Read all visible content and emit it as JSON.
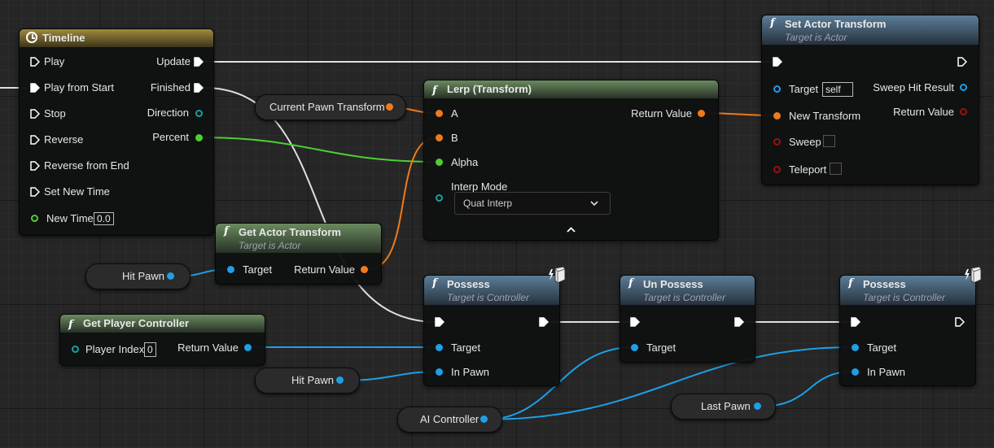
{
  "colors": {
    "exec": "#ffffff",
    "object": "#1e9fe6",
    "transform": "#f07a1a",
    "float": "#4fce32",
    "bool": "#9a1010",
    "int": "#1aa0a0"
  },
  "timeline": {
    "title": "Timeline",
    "icon": "clock-icon",
    "inputs": [
      "Play",
      "Play from Start",
      "Stop",
      "Reverse",
      "Reverse from End",
      "Set New Time",
      "New Time"
    ],
    "outputs": [
      "Update",
      "Finished",
      "Direction",
      "Percent"
    ],
    "new_time_value": "0.0"
  },
  "set_actor_transform": {
    "title": "Set Actor Transform",
    "subtitle": "Target is Actor",
    "target_label": "Target",
    "target_value": "self",
    "new_transform": "New Transform",
    "sweep": "Sweep",
    "teleport": "Teleport",
    "sweep_hit_result": "Sweep Hit Result",
    "return_value": "Return Value"
  },
  "current_pawn_transform": "Current Pawn Transform",
  "lerp": {
    "title": "Lerp (Transform)",
    "a": "A",
    "b": "B",
    "alpha": "Alpha",
    "interp_mode": "Interp Mode",
    "interp_value": "Quat Interp",
    "return_value": "Return Value"
  },
  "get_actor_transform": {
    "title": "Get Actor Transform",
    "subtitle": "Target is Actor",
    "target": "Target",
    "return_value": "Return Value"
  },
  "hit_pawn_var": "Hit Pawn",
  "get_player_controller": {
    "title": "Get Player Controller",
    "player_index": "Player Index",
    "player_index_value": "0",
    "return_value": "Return Value"
  },
  "hit_pawn_var2": "Hit Pawn",
  "possess1": {
    "title": "Possess",
    "subtitle": "Target is Controller",
    "target": "Target",
    "in_pawn": "In Pawn"
  },
  "unpossess": {
    "title": "Un Possess",
    "subtitle": "Target is Controller",
    "target": "Target"
  },
  "possess2": {
    "title": "Possess",
    "subtitle": "Target is Controller",
    "target": "Target",
    "in_pawn": "In Pawn"
  },
  "ai_controller_var": "AI Controller",
  "last_pawn_var": "Last Pawn"
}
